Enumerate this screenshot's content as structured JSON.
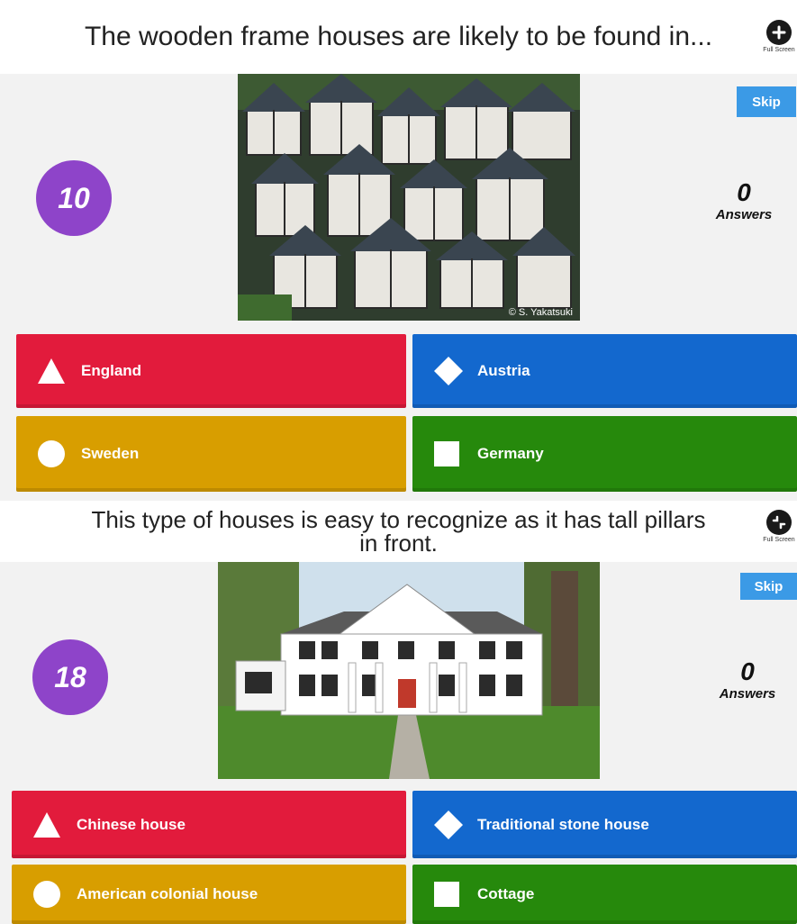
{
  "colors": {
    "red": "#e21b3c",
    "blue": "#1368ce",
    "gold": "#d89e00",
    "green": "#26890c",
    "timer_badge": "#8e44c9",
    "skip_button": "#3b9ae6"
  },
  "questions": [
    {
      "question_text": "The wooden frame houses are likely to be found in...",
      "fullscreen_label": "Full Screen",
      "fullscreen_icon": "expand-icon",
      "timer": "10",
      "skip_label": "Skip",
      "answers_count": "0",
      "answers_label": "Answers",
      "image_caption": "© S. Yakatsuki",
      "options": [
        {
          "shape": "triangle",
          "label": "England"
        },
        {
          "shape": "diamond",
          "label": "Austria"
        },
        {
          "shape": "circle",
          "label": "Sweden"
        },
        {
          "shape": "square",
          "label": "Germany"
        }
      ]
    },
    {
      "question_text_line1": "This type of houses is easy to recognize as it has tall pillars",
      "question_text_line2": "in front.",
      "fullscreen_label": "Full Screen",
      "fullscreen_icon": "collapse-icon",
      "timer": "18",
      "skip_label": "Skip",
      "answers_count": "0",
      "answers_label": "Answers",
      "options": [
        {
          "shape": "triangle",
          "label": "Chinese house"
        },
        {
          "shape": "diamond",
          "label": "Traditional stone house"
        },
        {
          "shape": "circle",
          "label": "American colonial house"
        },
        {
          "shape": "square",
          "label": "Cottage"
        }
      ]
    }
  ]
}
